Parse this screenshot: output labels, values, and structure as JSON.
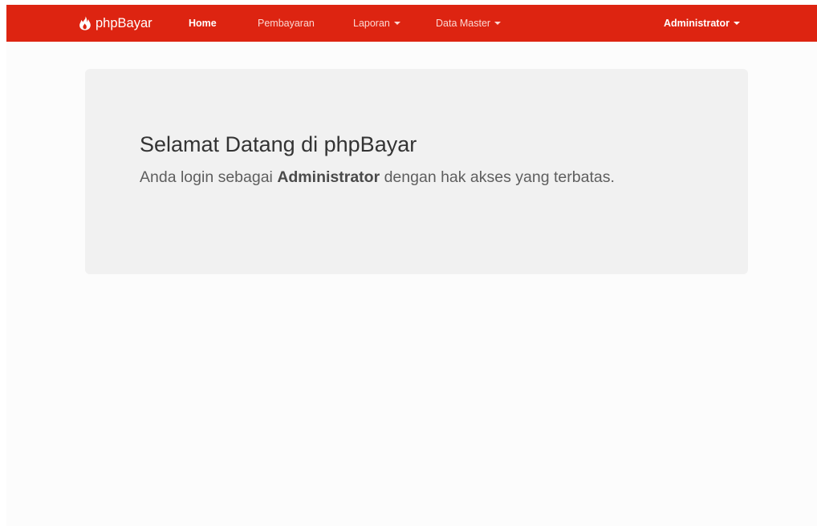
{
  "navbar": {
    "brand": "phpBayar",
    "brand_icon": "fire-icon",
    "items": [
      {
        "label": "Home",
        "active": true
      },
      {
        "label": "Pembayaran"
      },
      {
        "label": "Laporan",
        "dropdown": true
      },
      {
        "label": "Data Master",
        "dropdown": true
      }
    ],
    "user_menu": {
      "label": "Administrator",
      "dropdown": true
    },
    "background_color": "#dd2411"
  },
  "jumbotron": {
    "title": "Selamat Datang di phpBayar",
    "lead_before": "Anda login sebagai ",
    "lead_role": "Administrator",
    "lead_after": " dengan hak akses yang terbatas."
  }
}
